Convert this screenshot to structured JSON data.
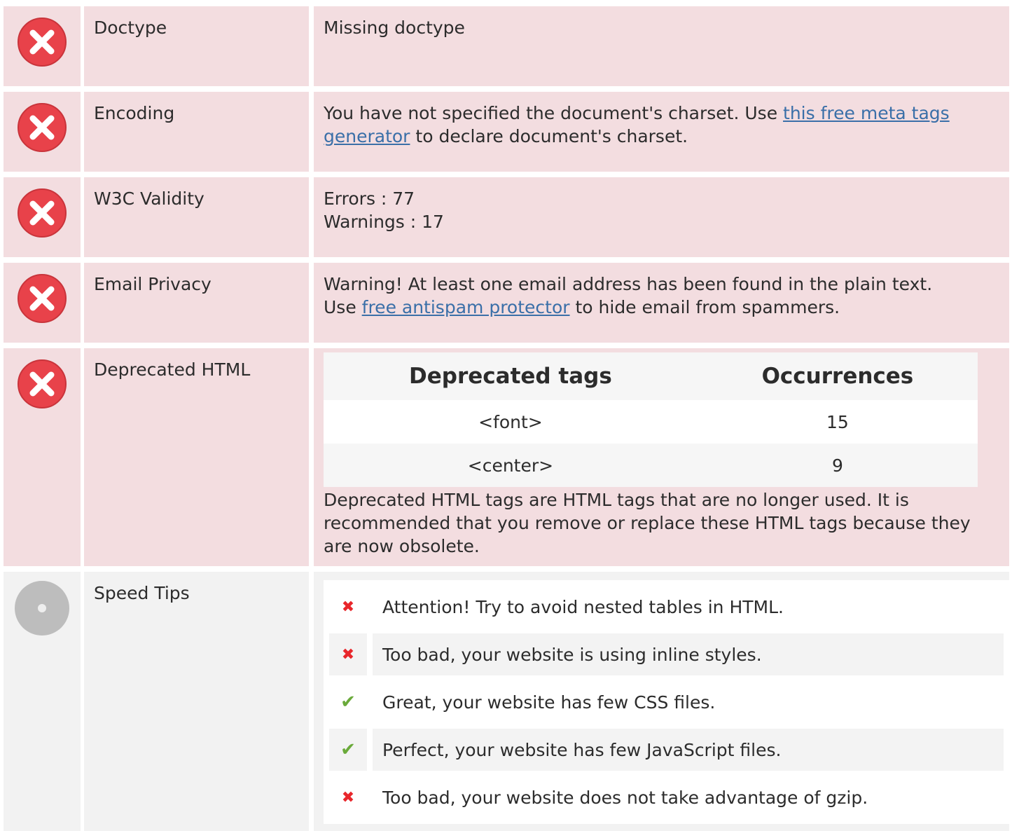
{
  "rows": {
    "doctype": {
      "name": "Doctype",
      "value": "Missing doctype"
    },
    "encoding": {
      "name": "Encoding",
      "text_before": "You have not specified the document's charset. Use ",
      "link_text": "this free meta tags generator",
      "text_after": " to declare document's charset."
    },
    "w3c": {
      "name": "W3C Validity",
      "errors": "Errors : 77",
      "warnings": "Warnings : 17"
    },
    "email": {
      "name": "Email Privacy",
      "line1": "Warning! At least one email address has been found in the plain text.",
      "text_before": "Use ",
      "link_text": "free antispam protector",
      "text_after": " to hide email from spammers."
    },
    "deprecated": {
      "name": "Deprecated HTML",
      "table": {
        "headers": [
          "Deprecated tags",
          "Occurrences"
        ],
        "rows": [
          {
            "tag": "<font>",
            "count": "15"
          },
          {
            "tag": "<center>",
            "count": "9"
          }
        ]
      },
      "note": "Deprecated HTML tags are HTML tags that are no longer used. It is recommended that you remove or replace these HTML tags because they are now obsolete."
    },
    "speed": {
      "name": "Speed Tips",
      "tips": [
        {
          "status": "bad",
          "icon": "cross-icon",
          "text": "Attention! Try to avoid nested tables in HTML."
        },
        {
          "status": "bad",
          "icon": "cross-icon",
          "text": "Too bad, your website is using inline styles."
        },
        {
          "status": "good",
          "icon": "check-icon",
          "text": "Great, your website has few CSS files."
        },
        {
          "status": "good",
          "icon": "check-icon",
          "text": "Perfect, your website has few JavaScript files."
        },
        {
          "status": "bad",
          "icon": "cross-icon",
          "text": "Too bad, your website does not take advantage of gzip."
        }
      ]
    }
  },
  "colors": {
    "error_bg": "#f3dde0",
    "neutral_bg": "#f2f2f2",
    "error_icon": "#e8424a",
    "neutral_icon": "#bdbdbd",
    "link": "#3a6fa8",
    "cross": "#e8262b",
    "check": "#6aaa3a"
  }
}
